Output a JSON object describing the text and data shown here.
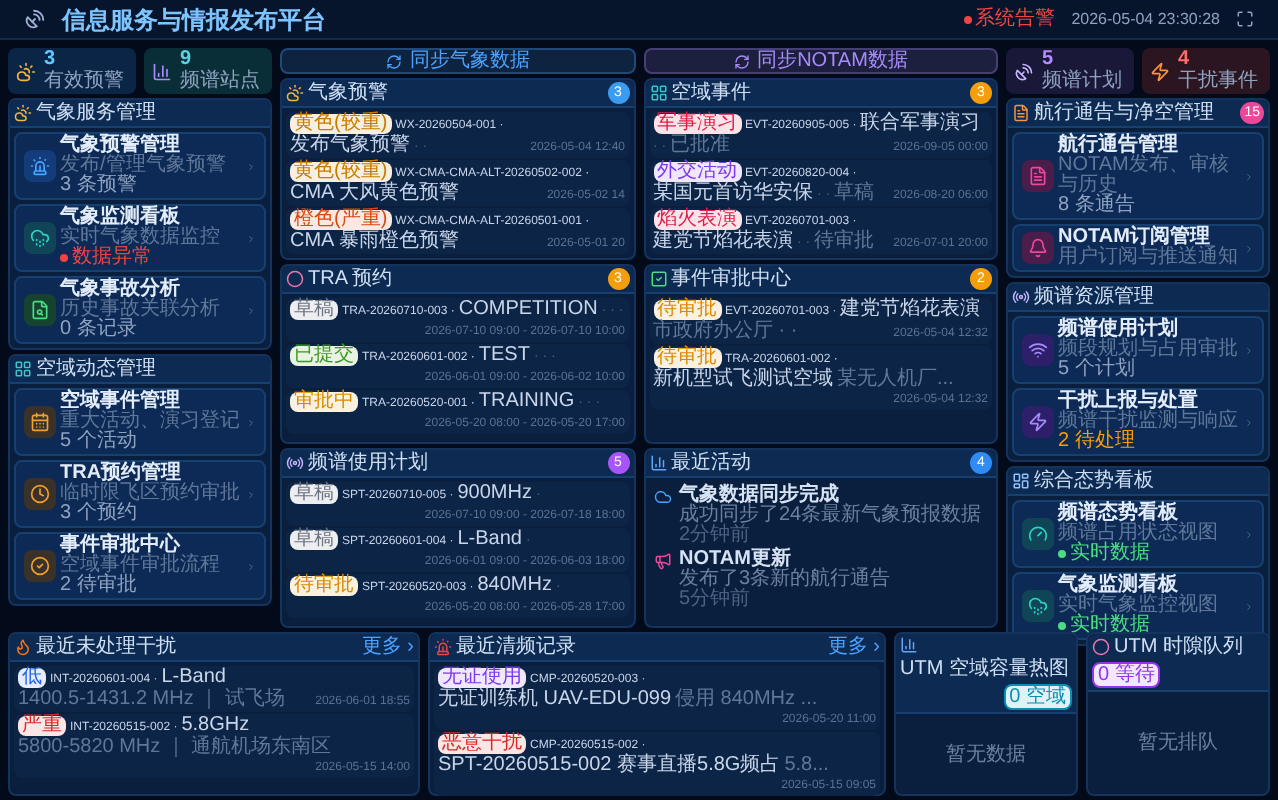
{
  "header": {
    "title": "信息服务与情报发布平台",
    "alert": {
      "label": "系统告警",
      "active": true
    },
    "time": "2026-05-04 23:30:28"
  },
  "left": {
    "stats": [
      {
        "kind": "weather",
        "value": "3",
        "label": "有效预警",
        "color": "#5ec8ff"
      },
      {
        "kind": "chart",
        "value": "9",
        "label": "频谱站点",
        "color": "#5ed0e0"
      }
    ],
    "panels": [
      {
        "kind": "weather",
        "title": "气象服务管理",
        "cards": [
          {
            "kind": "siren",
            "title": "气象预警管理",
            "subtitle": "发布/管理气象预警",
            "meta": {
              "text": "3 条预警",
              "color": "#8fa3c0",
              "dot": false
            }
          },
          {
            "kind": "cloud",
            "title": "气象监测看板",
            "subtitle": "实时气象数据监控",
            "meta": {
              "text": "数据异常",
              "color": "#ef4444",
              "dot": true
            }
          },
          {
            "kind": "search",
            "title": "气象事故分析",
            "subtitle": "历史事故关联分析",
            "meta": {
              "text": "0 条记录",
              "color": "#8fa3c0",
              "dot": false
            }
          }
        ]
      },
      {
        "kind": "grid",
        "title": "空域动态管理",
        "cards": [
          {
            "kind": "calendar",
            "title": "空域事件管理",
            "subtitle": "重大活动、演习登记",
            "meta": {
              "text": "5 个活动",
              "color": "#8fa3c0",
              "dot": false
            }
          },
          {
            "kind": "clock",
            "title": "TRA预约管理",
            "subtitle": "临时限飞区预约审批",
            "meta": {
              "text": "3 个预约",
              "color": "#8fa3c0",
              "dot": false
            }
          },
          {
            "kind": "check",
            "title": "事件审批中心",
            "subtitle": "空域事件审批流程",
            "meta": {
              "text": "2 待审批",
              "color": "#8fa3c0",
              "dot": false
            }
          }
        ]
      }
    ]
  },
  "columns": [
    {
      "sync": {
        "label": "同步气象数据",
        "color": "#4aa3ff"
      },
      "panels": [
        {
          "kind": "weather",
          "title": "气象预警",
          "count": {
            "value": "3",
            "color": "#3b9bf0"
          },
          "rows": [
            {
              "badge": {
                "label": "黄色(较重)",
                "color": "#c77a00"
              },
              "code": "WX-20260504-001 ·",
              "name": "发布气象预警",
              "trail": "· ·",
              "date": "2026-05-04 12:40"
            },
            {
              "badge": {
                "label": "黄色(较重)",
                "color": "#c77a00"
              },
              "code": "WX-CMA-CMA-ALT-20260502-002 ·",
              "name": "CMA 大风黄色预警",
              "date": "2026-05-02 14"
            },
            {
              "badge": {
                "label": "橙色(严重)",
                "color": "#d9480f"
              },
              "code": "WX-CMA-CMA-ALT-20260501-001 ·",
              "name": "CMA 暴雨橙色预警",
              "date": "2026-05-01 20"
            }
          ]
        },
        {
          "kind": "dot",
          "title": "TRA 预约",
          "count": {
            "value": "3",
            "color": "#f59e0b"
          },
          "rows": [
            {
              "badge": {
                "label": "草稿",
                "color": "#6b7280"
              },
              "code": "TRA-20260710-003 ·",
              "name": "COMPETITION",
              "trail": "· · ·",
              "date": "2026-07-10 09:00 - 2026-07-10 10:00"
            },
            {
              "badge": {
                "label": "已提交",
                "color": "#3f9a1f"
              },
              "code": "TRA-20260601-002 ·",
              "name": "TEST",
              "trail": "· · ·",
              "date": "2026-06-01 09:00 - 2026-06-02 10:00"
            },
            {
              "badge": {
                "label": "审批中",
                "color": "#d98a00"
              },
              "code": "TRA-20260520-001 ·",
              "name": "TRAINING",
              "trail": "· · ·",
              "date": "2026-05-20 08:00 - 2026-05-20 17:00"
            }
          ]
        },
        {
          "kind": "radio",
          "title": "频谱使用计划",
          "count": {
            "value": "5",
            "color": "#a855f7"
          },
          "rows": [
            {
              "badge": {
                "label": "草稿",
                "color": "#6b7280"
              },
              "code": "SPT-20260710-005 ·",
              "name": "900MHz",
              "trail": "·",
              "date": "2026-07-10 09:00 - 2026-07-18 18:00"
            },
            {
              "badge": {
                "label": "草稿",
                "color": "#6b7280"
              },
              "code": "SPT-20260601-004 ·",
              "name": "L-Band",
              "trail": "·",
              "date": "2026-06-01 09:00 - 2026-06-03 18:00"
            },
            {
              "badge": {
                "label": "待审批",
                "color": "#d98a00"
              },
              "code": "SPT-20260520-003 ·",
              "name": "840MHz",
              "trail": "·",
              "date": "2026-05-20 08:00 - 2026-05-28 17:00"
            }
          ]
        }
      ]
    },
    {
      "sync": {
        "label": "同步NOTAM数据",
        "color": "#a78bfa"
      },
      "panels": [
        {
          "kind": "grid",
          "title": "空域事件",
          "count": {
            "value": "3",
            "color": "#f59e0b"
          },
          "rows": [
            {
              "badge": {
                "label": "军事演习",
                "color": "#e11d48"
              },
              "code": "EVT-20260905-005 ·",
              "name": "联合军事演习",
              "trail": "· ·",
              "note": "已批准",
              "date": "2026-09-05 00:00"
            },
            {
              "badge": {
                "label": "外交活动",
                "color": "#7c3aed"
              },
              "code": "EVT-20260820-004 ·",
              "name": "某国元首访华安保",
              "trail": "· ·",
              "note": "草稿",
              "date": "2026-08-20 06:00"
            },
            {
              "badge": {
                "label": "焰火表演",
                "color": "#e11d48"
              },
              "code": "EVT-20260701-003 ·",
              "name": "建党节焰花表演",
              "trail": "· ·",
              "note": "待审批",
              "date": "2026-07-01 20:00"
            }
          ]
        },
        {
          "kind": "check",
          "title": "事件审批中心",
          "count": {
            "value": "2",
            "color": "#f59e0b"
          },
          "rows": [
            {
              "badge": {
                "label": "待审批",
                "color": "#d98a00"
              },
              "code": "EVT-20260701-003 ·",
              "name": "建党节焰花表演",
              "note": "市政府办公厅 · ·",
              "date": "2026-05-04 12:32"
            },
            {
              "badge": {
                "label": "待审批",
                "color": "#d98a00"
              },
              "code": "TRA-20260601-002 ·",
              "name": "新机型试飞测试空域",
              "note": "某无人机厂...",
              "date": "2026-05-04 12:32"
            }
          ]
        },
        {
          "kind": "bars",
          "title": "最近活动",
          "count": {
            "value": "4",
            "color": "#2f8cf5"
          },
          "activities": [
            {
              "kind": "cloud",
              "title": "气象数据同步完成",
              "text": "成功同步了24条最新气象预报数据",
              "time": "2分钟前"
            },
            {
              "kind": "megaphone",
              "title": "NOTAM更新",
              "text": "发布了3条新的航行通告",
              "time": "5分钟前"
            }
          ]
        }
      ]
    }
  ],
  "right": {
    "stats": [
      {
        "kind": "dish",
        "value": "5",
        "label": "频谱计划",
        "color": "#b38cff"
      },
      {
        "kind": "zap",
        "value": "4",
        "label": "干扰事件",
        "color": "#ff6b6b"
      }
    ],
    "panels": [
      {
        "kind": "file",
        "title": "航行通告与净空管理",
        "count": {
          "value": "15",
          "color": "#ec4899"
        },
        "cards": [
          {
            "kind": "file",
            "title": "航行通告管理",
            "subtitle": "NOTAM发布、审核与历史",
            "meta": {
              "text": "8 条通告",
              "color": "#8fa3c0",
              "dot": false
            }
          },
          {
            "kind": "bell",
            "title": "NOTAM订阅管理",
            "subtitle": "用户订阅与推送通知"
          }
        ]
      },
      {
        "kind": "radio",
        "title": "频谱资源管理",
        "cards": [
          {
            "kind": "wifi",
            "title": "频谱使用计划",
            "subtitle": "频段规划与占用审批",
            "meta": {
              "text": "5 个计划",
              "color": "#8fa3c0",
              "dot": false
            }
          },
          {
            "kind": "zap",
            "title": "干扰上报与处置",
            "subtitle": "频谱干扰监测与响应",
            "meta": {
              "text": "2 待处理",
              "color": "#f59e0b",
              "dot": false
            }
          }
        ]
      },
      {
        "kind": "board",
        "title": "综合态势看板",
        "cards": [
          {
            "kind": "gauge",
            "title": "频谱态势看板",
            "subtitle": "频谱占用状态视图",
            "meta": {
              "text": "实时数据",
              "color": "#4ade80",
              "dot": true
            }
          },
          {
            "kind": "cloud",
            "title": "气象监测看板",
            "subtitle": "实时气象监控视图",
            "meta": {
              "text": "实时数据",
              "color": "#4ade80",
              "dot": true
            }
          }
        ]
      }
    ]
  },
  "bottom": [
    {
      "kind": "flame",
      "title": "最近未处理干扰",
      "more": "更多 ›",
      "rows": [
        {
          "badge": {
            "label": "低",
            "color": "#2563eb"
          },
          "code": "INT-20260601-004 ·",
          "name": "L-Band",
          "note": "1400.5-1431.2 MHz ｜ 试飞场",
          "date": "2026-06-01 18:55"
        },
        {
          "badge": {
            "label": "严重",
            "color": "#dc2626"
          },
          "code": "INT-20260515-002 ·",
          "name": "5.8GHz",
          "note": "5800-5820 MHz ｜ 通航机场东南区",
          "date": "2026-05-15 14:00"
        }
      ]
    },
    {
      "kind": "siren",
      "title": "最近清频记录",
      "more": "更多 ›",
      "rows": [
        {
          "badge": {
            "label": "无证使用",
            "color": "#7c3aed"
          },
          "code": "CMP-20260520-003 ·",
          "name": "无证训练机 UAV-EDU-099",
          "note": "侵用 840MHz ...",
          "date": "2026-05-20 11:00"
        },
        {
          "badge": {
            "label": "恶意干扰",
            "color": "#dc2626"
          },
          "code": "CMP-20260515-002 ·",
          "name": "SPT-20260515-002 赛事直播5.8G频占",
          "note": "5.8...",
          "date": "2026-05-15 09:05"
        }
      ]
    },
    {
      "kind": "bars",
      "title": "UTM 空域容量热图",
      "tag": {
        "label": "0 空域",
        "color": "#0891b2"
      },
      "empty": "暂无数据"
    },
    {
      "kind": "dot",
      "title": "UTM 时隙队列",
      "tag": {
        "label": "0 等待",
        "color": "#9333ea"
      },
      "empty": "暂无排队"
    }
  ]
}
